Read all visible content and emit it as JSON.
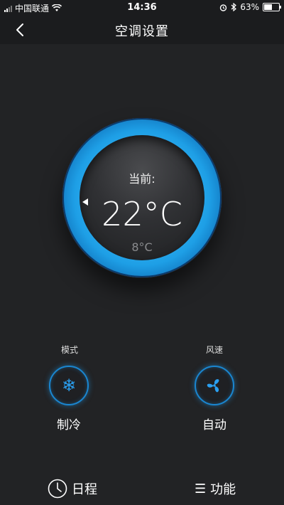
{
  "status_bar": {
    "carrier": "中国联通",
    "time": "14:36",
    "battery_text": "63%",
    "battery_level": 0.63,
    "icons": [
      "signal-icon",
      "wifi-icon",
      "alarm-icon",
      "bluetooth-icon",
      "battery-icon"
    ]
  },
  "nav": {
    "title": "空调设置",
    "back_icon": "chevron-left-icon"
  },
  "dial": {
    "current_label": "当前:",
    "current_temp": "22°C",
    "set_temp": "8°C",
    "ring_color": "#1e9fe6"
  },
  "controls": {
    "mode": {
      "label": "模式",
      "value": "制冷",
      "icon": "snowflake-icon"
    },
    "fan": {
      "label": "风速",
      "value": "自动",
      "icon": "fan-icon"
    },
    "accent_color": "#2a9ff0"
  },
  "bottom_bar": {
    "schedule_label": "日程",
    "schedule_icon": "clock-icon",
    "function_label": "功能",
    "function_icon": "menu-icon"
  }
}
